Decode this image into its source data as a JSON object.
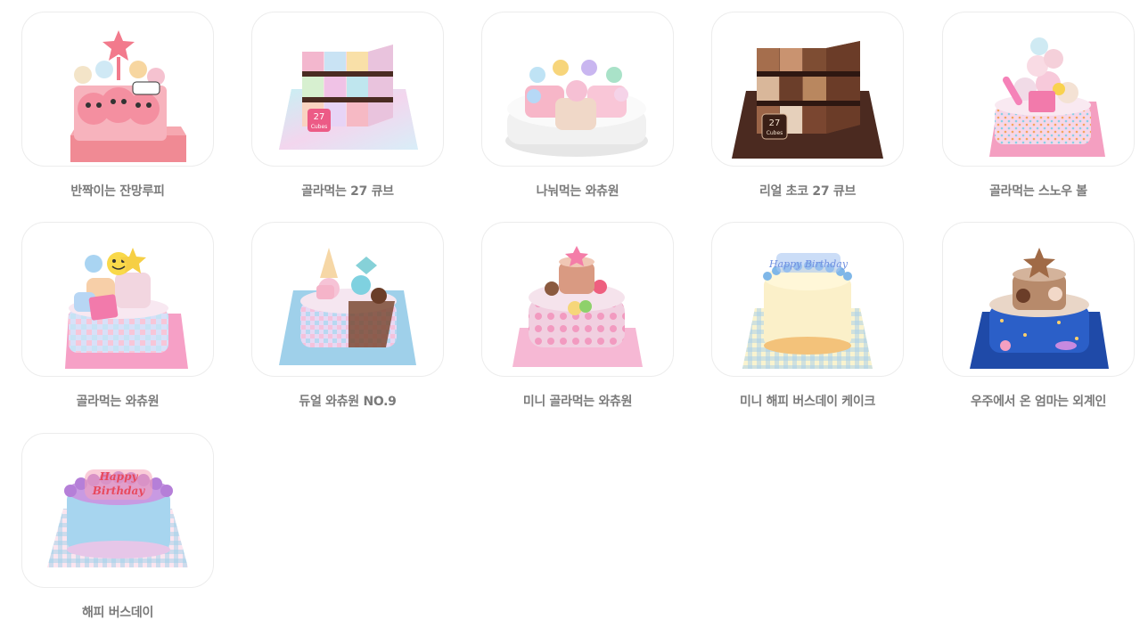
{
  "products": [
    {
      "name": "반짝이는 잔망루피",
      "icon": "loopy-cake-icon"
    },
    {
      "name": "골라먹는 27 큐브",
      "icon": "cube-cake-icon",
      "badge": "27\nCubes"
    },
    {
      "name": "나눠먹는 와츄원",
      "icon": "split-cake-icon"
    },
    {
      "name": "리얼 초코 27 큐브",
      "icon": "choco-cube-cake-icon",
      "badge": "27\nCubes"
    },
    {
      "name": "골라먹는 스노우 볼",
      "icon": "snowball-cake-icon"
    },
    {
      "name": "골라먹는 와츄원",
      "icon": "whatchu-cake-icon"
    },
    {
      "name": "듀얼 와츄원 NO.9",
      "icon": "dual-cake-icon"
    },
    {
      "name": "미니 골라먹는 와츄원",
      "icon": "mini-cake-icon"
    },
    {
      "name": "미니 해피 버스데이 케이크",
      "icon": "mini-birthday-cake-icon",
      "topper": "Happy Birthday"
    },
    {
      "name": "우주에서 온 엄마는 외계인",
      "icon": "space-cake-icon"
    },
    {
      "name": "해피 버스데이",
      "icon": "birthday-cake-icon",
      "topper": "Happy Birthday"
    }
  ]
}
